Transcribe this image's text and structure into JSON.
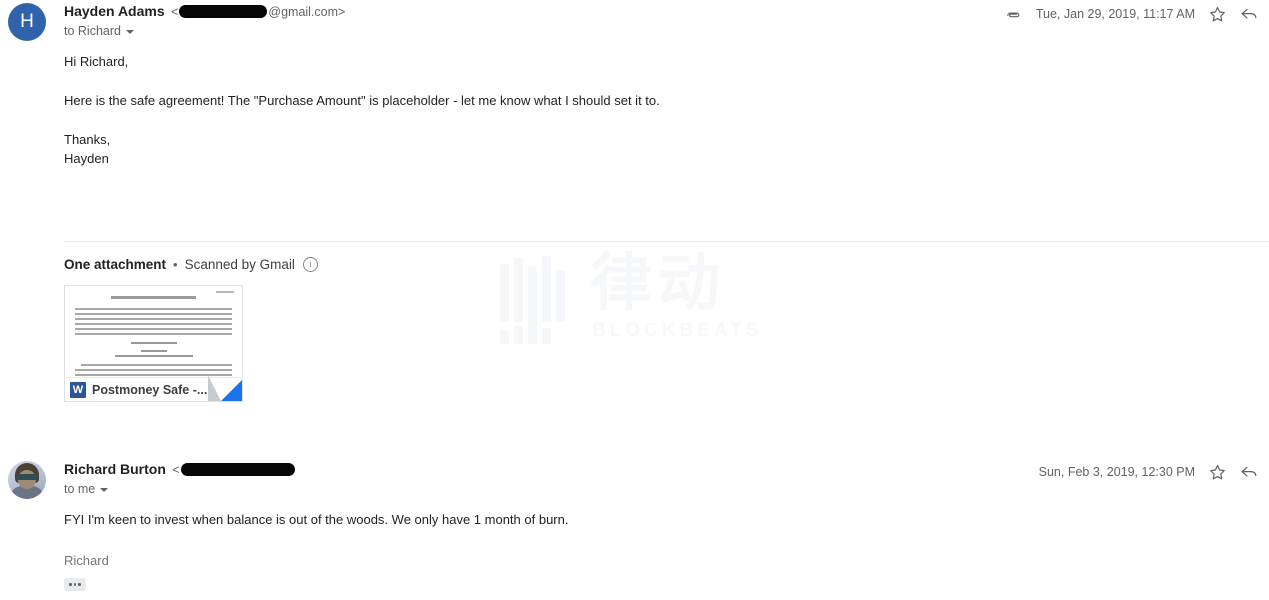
{
  "watermark": {
    "characters": "律动",
    "subtitle": "BLOCKBEATS"
  },
  "messages": [
    {
      "id": "message-1",
      "avatar": {
        "type": "initial",
        "letter": "H",
        "color": "#3063ab"
      },
      "sender_name": "Hayden Adams",
      "email_prefix": "<",
      "email_redacted": true,
      "email_suffix": "@gmail.com>",
      "recipient_label": "to Richard",
      "timestamp": "Tue, Jan 29, 2019, 11:17 AM",
      "has_attachment_icon": true,
      "icons": {
        "attachment": "paperclip-icon",
        "star": "star-icon",
        "reply": "reply-icon"
      },
      "body": {
        "greeting": "Hi Richard,",
        "main": "Here is the safe agreement! The \"Purchase Amount\" is placeholder - let me know what I should set it to.",
        "signoff": "Thanks,\nHayden"
      },
      "attachment_section": {
        "title": "One attachment",
        "separator": "•",
        "scanned_label": "Scanned by Gmail",
        "info_icon": "info-icon",
        "file": {
          "icon": "word-document-icon",
          "icon_letter": "W",
          "name": "Postmoney Safe -..."
        }
      }
    },
    {
      "id": "message-2",
      "avatar": {
        "type": "photo",
        "alt": "user-photo"
      },
      "sender_name": "Richard Burton",
      "email_prefix": "<",
      "email_redacted": true,
      "email_suffix": "",
      "recipient_label": "to me",
      "timestamp": "Sun, Feb 3, 2019, 12:30 PM",
      "has_attachment_icon": false,
      "icons": {
        "star": "star-icon",
        "reply": "reply-icon"
      },
      "body": {
        "main": "FYI I'm keen to invest when balance is out of the woods. We only have 1 month of burn.",
        "signature": "Richard"
      },
      "trimmed_content_label": "•••"
    }
  ]
}
